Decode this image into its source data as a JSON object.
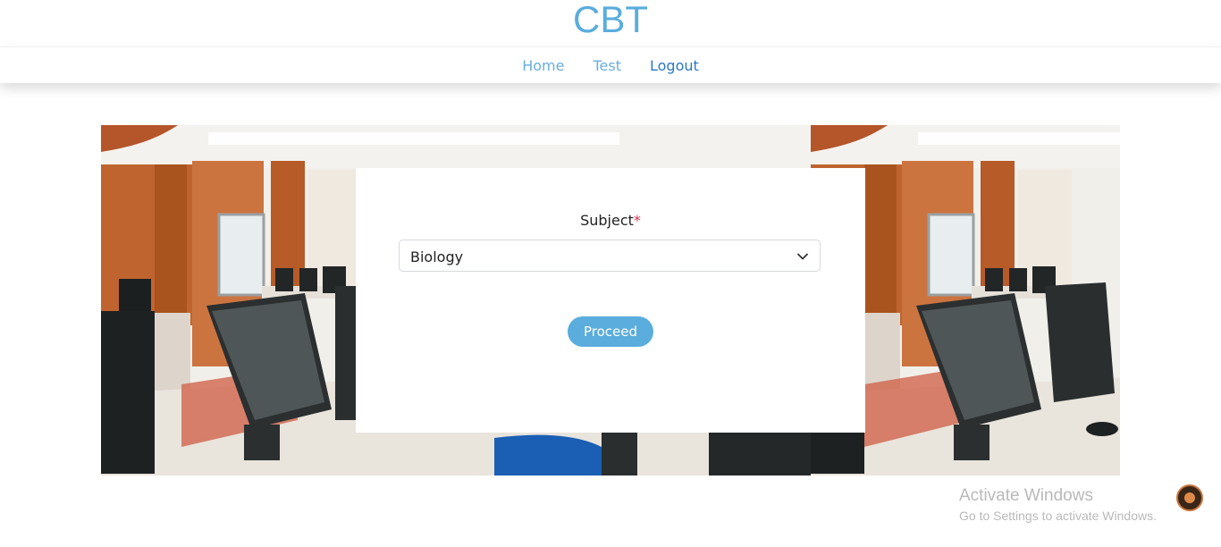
{
  "header": {
    "brand": "CBT"
  },
  "nav": {
    "items": [
      {
        "label": "Home"
      },
      {
        "label": "Test"
      },
      {
        "label": "Logout"
      }
    ]
  },
  "form": {
    "subject_label": "Subject",
    "required_mark": "*",
    "subject_value": "Biology",
    "proceed_label": "Proceed"
  },
  "os_overlay": {
    "title": "Activate Windows",
    "subtitle": "Go to Settings to activate Windows."
  },
  "colors": {
    "accent": "#5aaddd",
    "logout_link": "#2c78c4",
    "required": "#d1334b"
  },
  "icons": {
    "dropdown": "chevron-down-icon",
    "tray": "app-tray-icon"
  }
}
